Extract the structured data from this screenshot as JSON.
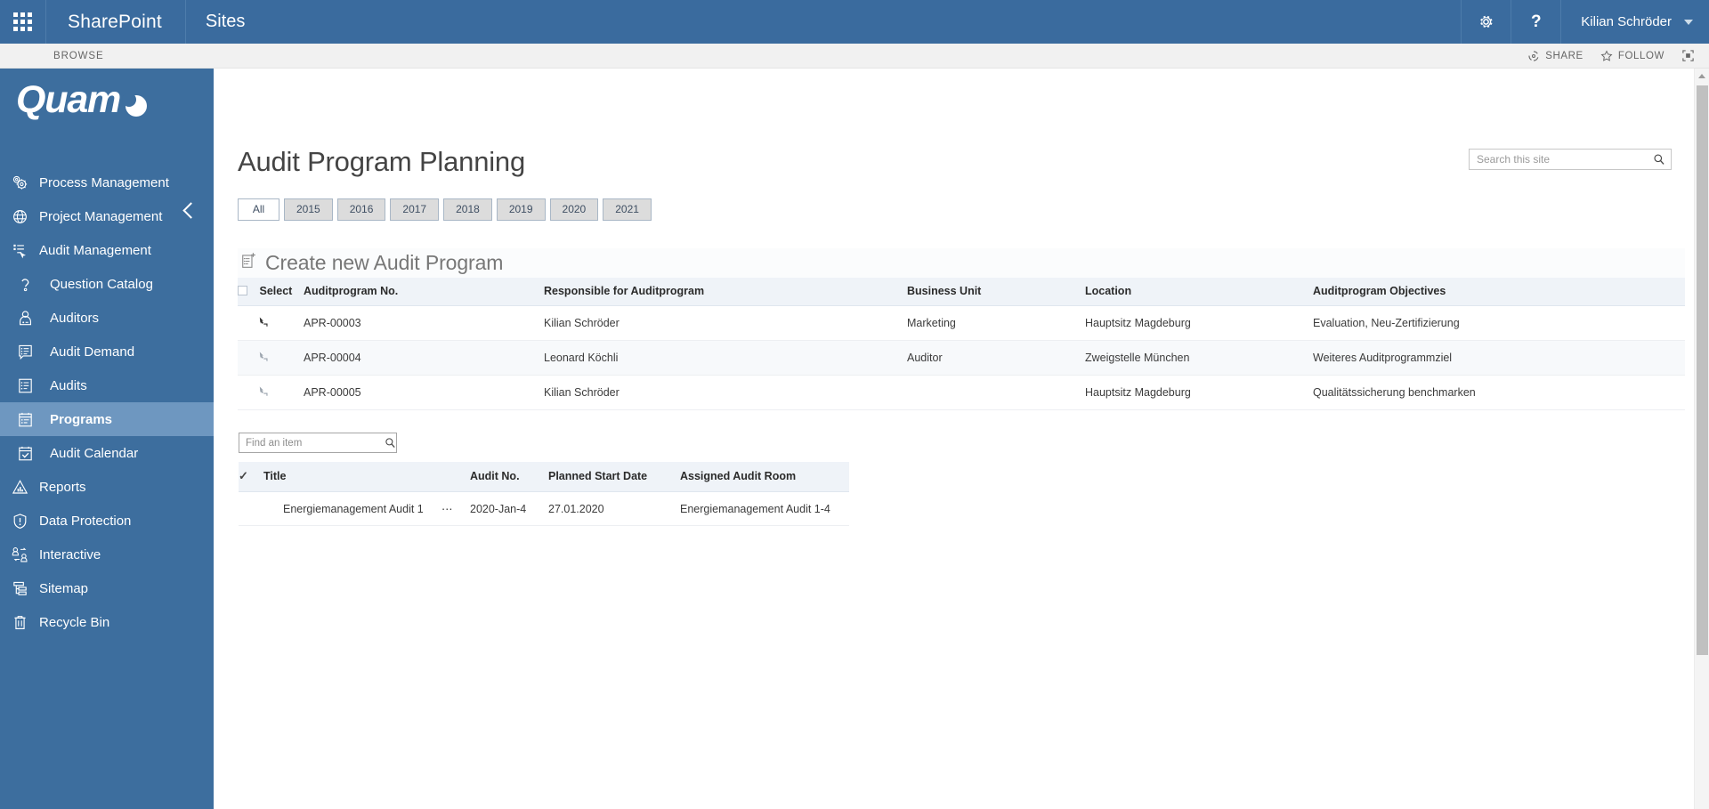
{
  "suite_bar": {
    "waffle_icon": "app-launcher-grid-icon",
    "brand": "SharePoint",
    "sites_label": "Sites",
    "settings_icon": "gear-icon",
    "help_icon": "question-mark-icon",
    "user_name": "Kilian Schröder",
    "user_caret_icon": "chevron-down-icon"
  },
  "ribbon": {
    "browse_tab": "BROWSE",
    "share_label": "SHARE",
    "share_icon": "share-icon",
    "follow_label": "FOLLOW",
    "follow_icon": "star-icon",
    "focus_icon": "focus-on-content-icon"
  },
  "sidebar": {
    "logo_text": "Quam",
    "logo_mark_icon": "quam-crescent-icon",
    "collapse_icon": "chevron-left-icon",
    "items": [
      {
        "label": "Process Management",
        "icon": "gears-icon",
        "level": "top",
        "active": false
      },
      {
        "label": "Project Management",
        "icon": "globe-icon",
        "level": "top",
        "active": false
      },
      {
        "label": "Audit Management",
        "icon": "audit-cursor-icon",
        "level": "top",
        "active": false
      },
      {
        "label": "Question Catalog",
        "icon": "question-mark-icon",
        "level": "sub",
        "active": false
      },
      {
        "label": "Auditors",
        "icon": "person-badge-icon",
        "level": "sub",
        "active": false
      },
      {
        "label": "Audit Demand",
        "icon": "list-speech-icon",
        "level": "sub",
        "active": false
      },
      {
        "label": "Audits",
        "icon": "list-document-icon",
        "level": "sub",
        "active": false
      },
      {
        "label": "Programs",
        "icon": "clipboard-list-icon",
        "level": "sub",
        "active": true
      },
      {
        "label": "Audit Calendar",
        "icon": "calendar-check-icon",
        "level": "sub",
        "active": false
      },
      {
        "label": "Reports",
        "icon": "bar-chart-icon",
        "level": "top",
        "active": false
      },
      {
        "label": "Data Protection",
        "icon": "shield-alert-icon",
        "level": "top",
        "active": false
      },
      {
        "label": "Interactive",
        "icon": "two-people-exchange-icon",
        "level": "top",
        "active": false
      },
      {
        "label": "Sitemap",
        "icon": "sitemap-icon",
        "level": "top",
        "active": false
      },
      {
        "label": "Recycle Bin",
        "icon": "trash-bin-icon",
        "level": "top",
        "active": false
      }
    ]
  },
  "search": {
    "placeholder": "Search this site",
    "value": "",
    "icon": "search-magnifier-icon"
  },
  "page": {
    "title": "Audit Program Planning"
  },
  "year_tabs": {
    "selected": "All",
    "items": [
      "All",
      "2015",
      "2016",
      "2017",
      "2018",
      "2019",
      "2020",
      "2021"
    ]
  },
  "create_link": {
    "label": "Create new Audit Program",
    "icon": "new-clipboard-plus-icon"
  },
  "programs_table": {
    "select_all_icon": "checkbox-unchecked-icon",
    "columns": [
      "Select",
      "Auditprogram No.",
      "Responsible for Auditprogram",
      "Business Unit",
      "Location",
      "Auditprogram Objectives"
    ],
    "rows": [
      {
        "select_icon": "expand-row-icon",
        "number": "APR-00003",
        "responsible": "Kilian Schröder",
        "business_unit": "Marketing",
        "location": "Hauptsitz Magdeburg",
        "objectives": "Evaluation, Neu-Zertifizierung"
      },
      {
        "select_icon": "expand-row-icon",
        "number": "APR-00004",
        "responsible": "Leonard Köchli",
        "business_unit": "Auditor",
        "location": "Zweigstelle München",
        "objectives": "Weiteres Auditprogrammziel"
      },
      {
        "select_icon": "expand-row-icon",
        "number": "APR-00005",
        "responsible": "Kilian Schröder",
        "business_unit": "",
        "location": "Hauptsitz Magdeburg",
        "objectives": "Qualitätssicherung benchmarken"
      }
    ]
  },
  "find_item": {
    "placeholder": "Find an item",
    "value": "",
    "icon": "search-magnifier-icon"
  },
  "audits_table": {
    "check_header_icon": "checkmark-icon",
    "columns": [
      "Title",
      "Audit No.",
      "Planned Start Date",
      "Assigned Audit Room"
    ],
    "rows": [
      {
        "title": "Energiemanagement Audit 1",
        "menu_icon": "ellipsis-icon",
        "audit_no": "2020-Jan-4",
        "planned_start": "27.01.2020",
        "audit_room": "Energiemanagement Audit 1-4"
      }
    ]
  },
  "scrollbar": {
    "up_arrow_icon": "scroll-up-arrow-icon"
  },
  "colors": {
    "suite_bar": "#3a6b9e",
    "sidebar": "#3d6e9e",
    "sidebar_active": "#6e97c0",
    "link": "#5b7fa6",
    "table_header": "#eff3f8"
  }
}
